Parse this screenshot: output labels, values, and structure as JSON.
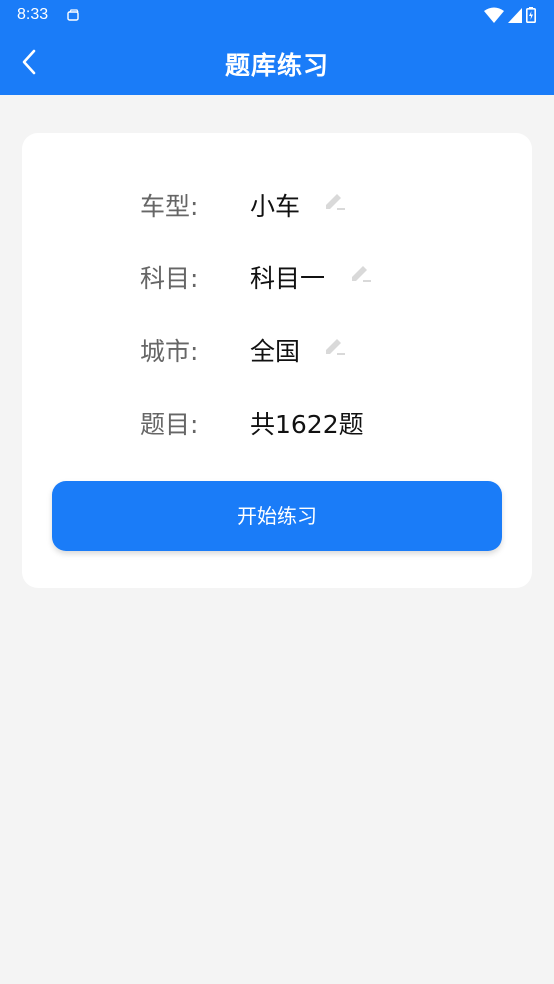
{
  "status_bar": {
    "time": "8:33",
    "icons": [
      "notification-icon",
      "wifi-icon",
      "signal-icon",
      "battery-icon"
    ]
  },
  "app_bar": {
    "title": "题库练习",
    "back_icon": "chevron-left-icon"
  },
  "form": {
    "rows": [
      {
        "label": "车型:",
        "value": "小车",
        "editable": true
      },
      {
        "label": "科目:",
        "value": "科目一",
        "editable": true
      },
      {
        "label": "城市:",
        "value": "全国",
        "editable": true
      },
      {
        "label": "题目:",
        "value": "共1622题",
        "editable": false
      }
    ]
  },
  "start_button": {
    "label": "开始练习"
  },
  "colors": {
    "primary": "#1a7cf8",
    "background": "#f4f4f4",
    "card": "#ffffff",
    "label": "#666666",
    "edit_icon": "#d9d9d9"
  }
}
